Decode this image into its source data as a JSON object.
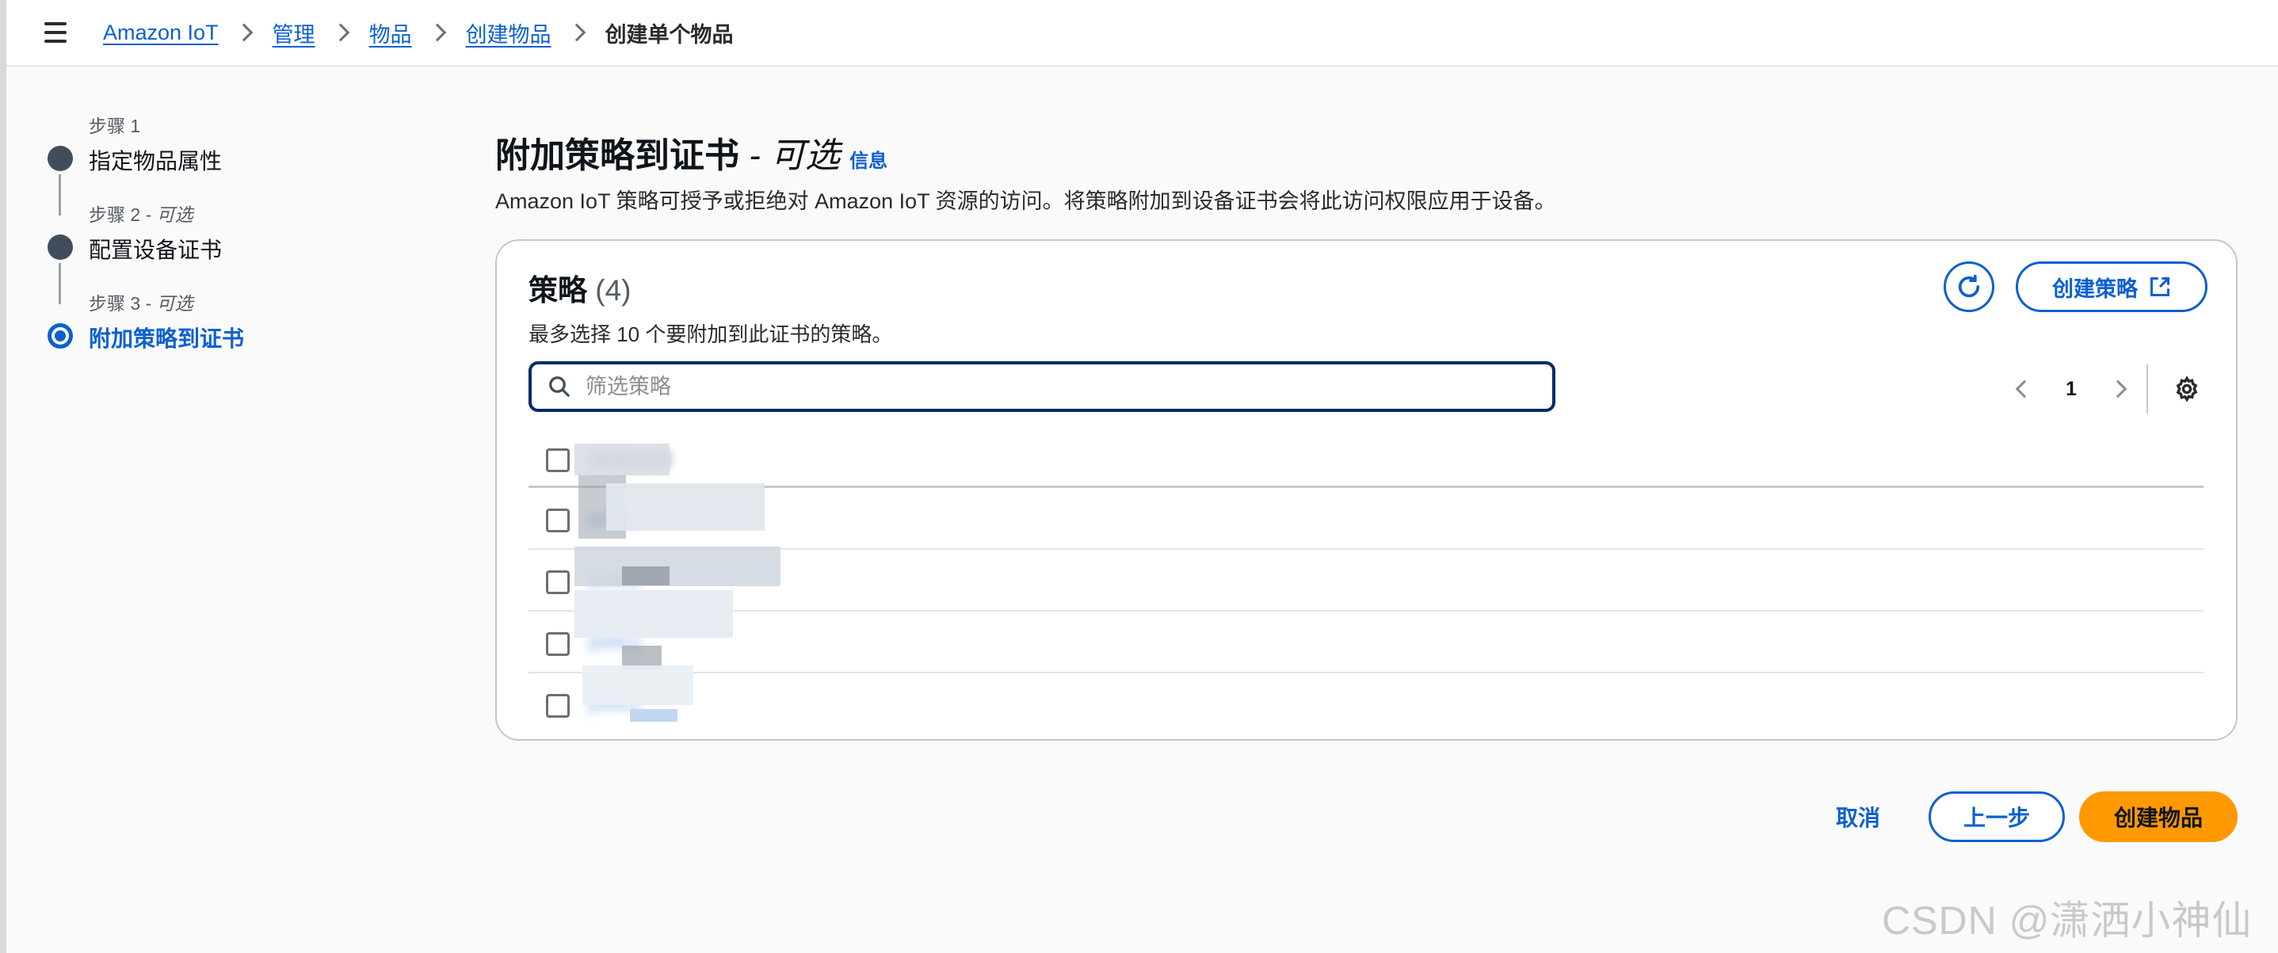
{
  "breadcrumb": {
    "items": [
      "Amazon IoT",
      "管理",
      "物品",
      "创建物品"
    ],
    "current": "创建单个物品"
  },
  "steps": [
    {
      "number": "步骤 1",
      "optional": "",
      "title": "指定物品属性"
    },
    {
      "number": "步骤 2 - ",
      "optional": "可选",
      "title": "配置设备证书"
    },
    {
      "number": "步骤 3 - ",
      "optional": "可选",
      "title": "附加策略到证书"
    }
  ],
  "header": {
    "title": "附加策略到证书",
    "title_optional": " - 可选",
    "info_link": "信息",
    "description": "Amazon IoT 策略可授予或拒绝对 Amazon IoT 资源的访问。将策略附加到设备证书会将此访问权限应用于设备。"
  },
  "policies": {
    "title": "策略",
    "count": "(4)",
    "subtitle": "最多选择 10 个要附加到此证书的策略。",
    "create_button": "创建策略",
    "search_placeholder": "筛选策略",
    "search_value": "",
    "page": "1",
    "column_header": "策略名称",
    "rows": [
      "policy",
      "policy",
      "policy",
      "policy"
    ]
  },
  "footer": {
    "cancel": "取消",
    "previous": "上一步",
    "create": "创建物品"
  },
  "watermark": "CSDN @潇洒小神仙",
  "colors": {
    "link": "#0b60d0",
    "primary_button": "#ff9900",
    "search_border": "#002b66"
  },
  "icons": [
    "menu-icon",
    "chevron-right-icon",
    "refresh-icon",
    "external-link-icon",
    "search-icon",
    "chevron-left-icon",
    "settings-icon"
  ]
}
